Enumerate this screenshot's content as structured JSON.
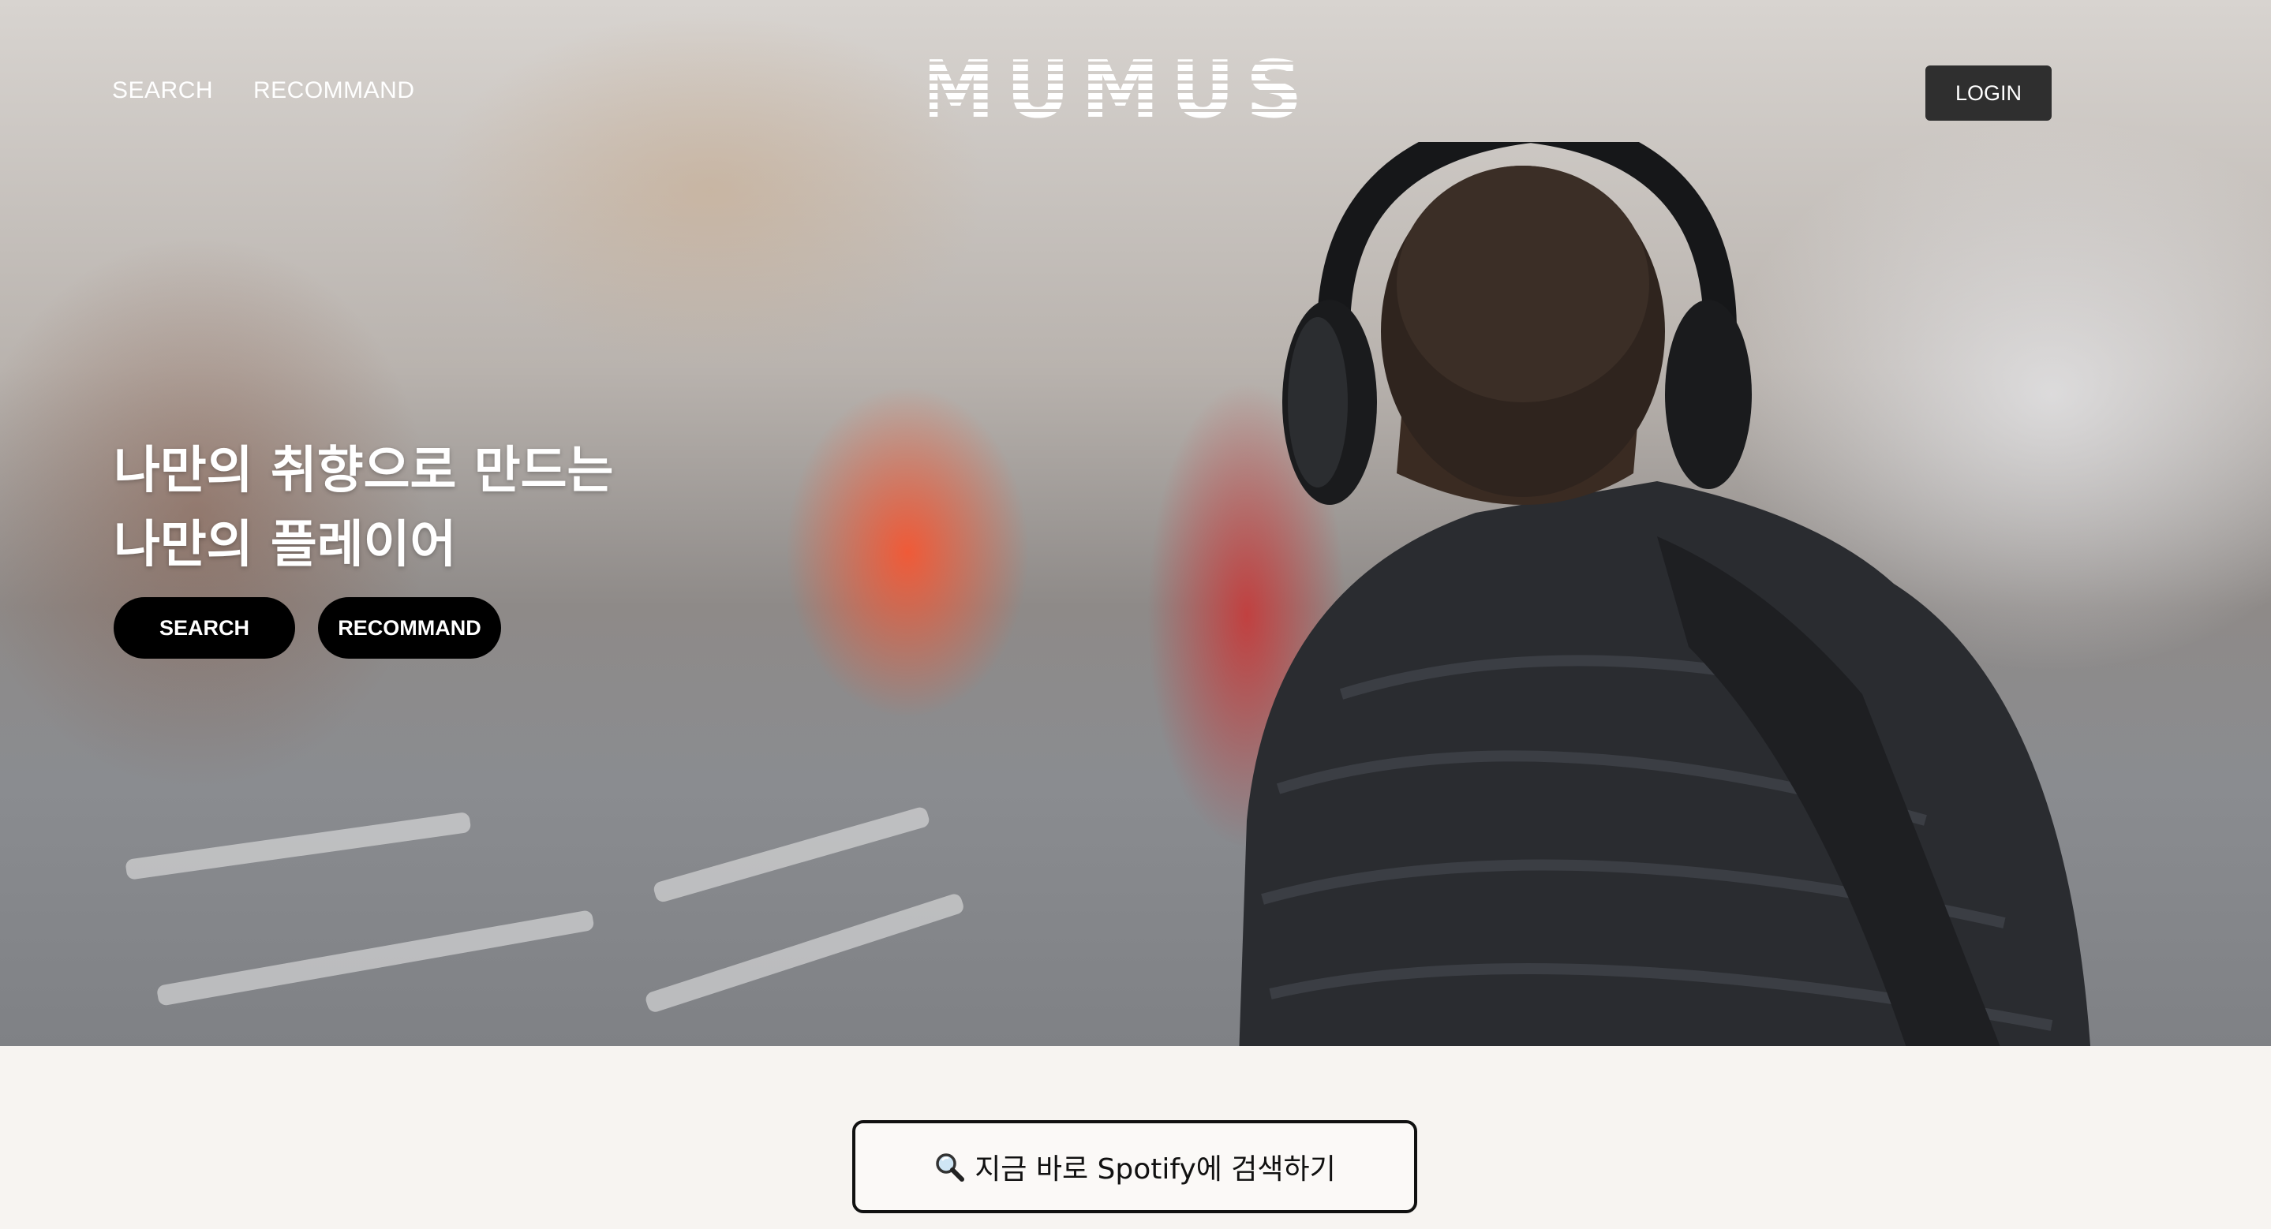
{
  "nav": {
    "search_label": "SEARCH",
    "recommend_label": "RECOMMAND",
    "logo_text": "MUMUS",
    "login_label": "LOGIN"
  },
  "hero": {
    "headline_line1": "나만의 취향으로 만드는",
    "headline_line2": "나만의 플레이어",
    "search_button": "SEARCH",
    "recommend_button": "RECOMMAND"
  },
  "bottom": {
    "search_icon": "magnifier-icon",
    "spotify_search_label": "지금 바로 Spotify에 검색하기"
  },
  "colors": {
    "page_background": "#f7f4f1",
    "login_background": "#2f2f2f",
    "pill_background": "#000000"
  }
}
